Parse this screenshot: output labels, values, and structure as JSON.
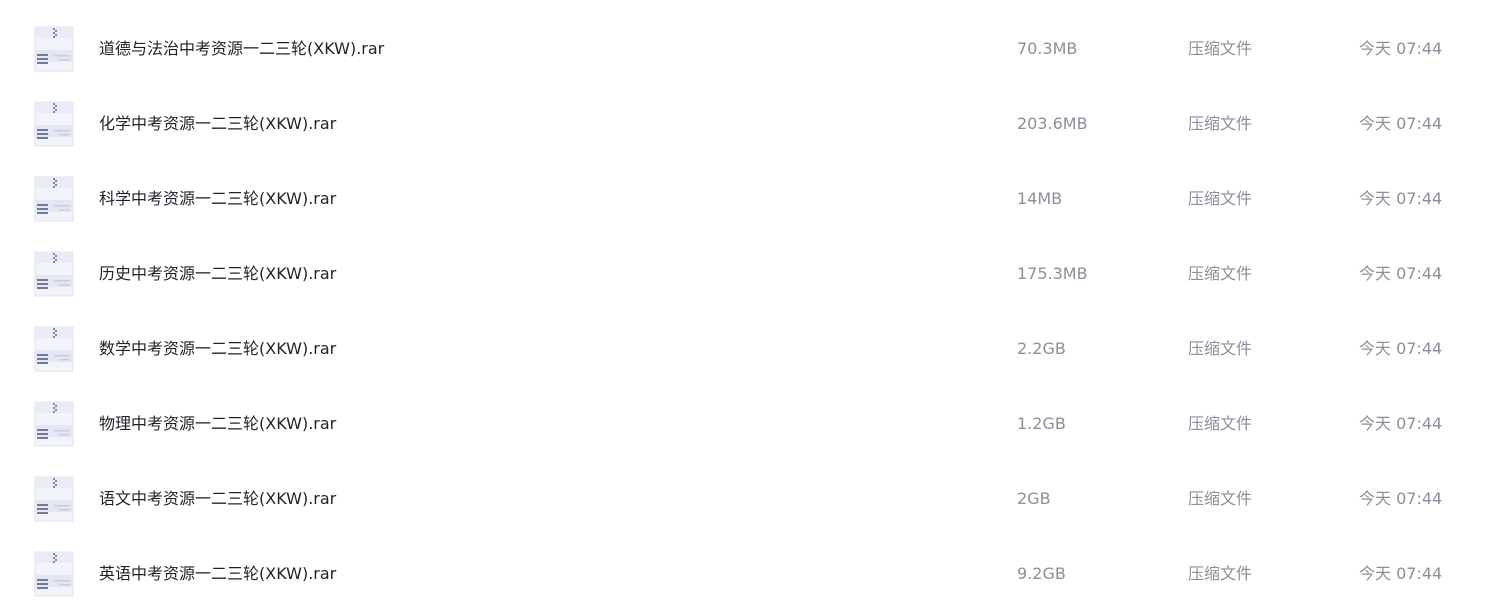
{
  "files": [
    {
      "name": "道德与法治中考资源一二三轮(XKW).rar",
      "size": "70.3MB",
      "type": "压缩文件",
      "modified": "今天 07:44",
      "icon": "zip-archive-icon"
    },
    {
      "name": "化学中考资源一二三轮(XKW).rar",
      "size": "203.6MB",
      "type": "压缩文件",
      "modified": "今天 07:44",
      "icon": "zip-archive-icon"
    },
    {
      "name": "科学中考资源一二三轮(XKW).rar",
      "size": "14MB",
      "type": "压缩文件",
      "modified": "今天 07:44",
      "icon": "zip-archive-icon"
    },
    {
      "name": "历史中考资源一二三轮(XKW).rar",
      "size": "175.3MB",
      "type": "压缩文件",
      "modified": "今天 07:44",
      "icon": "zip-archive-icon"
    },
    {
      "name": "数学中考资源一二三轮(XKW).rar",
      "size": "2.2GB",
      "type": "压缩文件",
      "modified": "今天 07:44",
      "icon": "zip-archive-icon"
    },
    {
      "name": "物理中考资源一二三轮(XKW).rar",
      "size": "1.2GB",
      "type": "压缩文件",
      "modified": "今天 07:44",
      "icon": "zip-archive-icon"
    },
    {
      "name": "语文中考资源一二三轮(XKW).rar",
      "size": "2GB",
      "type": "压缩文件",
      "modified": "今天 07:44",
      "icon": "zip-archive-icon"
    },
    {
      "name": "英语中考资源一二三轮(XKW).rar",
      "size": "9.2GB",
      "type": "压缩文件",
      "modified": "今天 07:44",
      "icon": "zip-archive-icon"
    }
  ],
  "colors": {
    "name_text": "#1f2329",
    "meta_text": "#8a8f99",
    "icon_body": "#e9ecf5",
    "icon_accent": "#7e8aa6"
  }
}
